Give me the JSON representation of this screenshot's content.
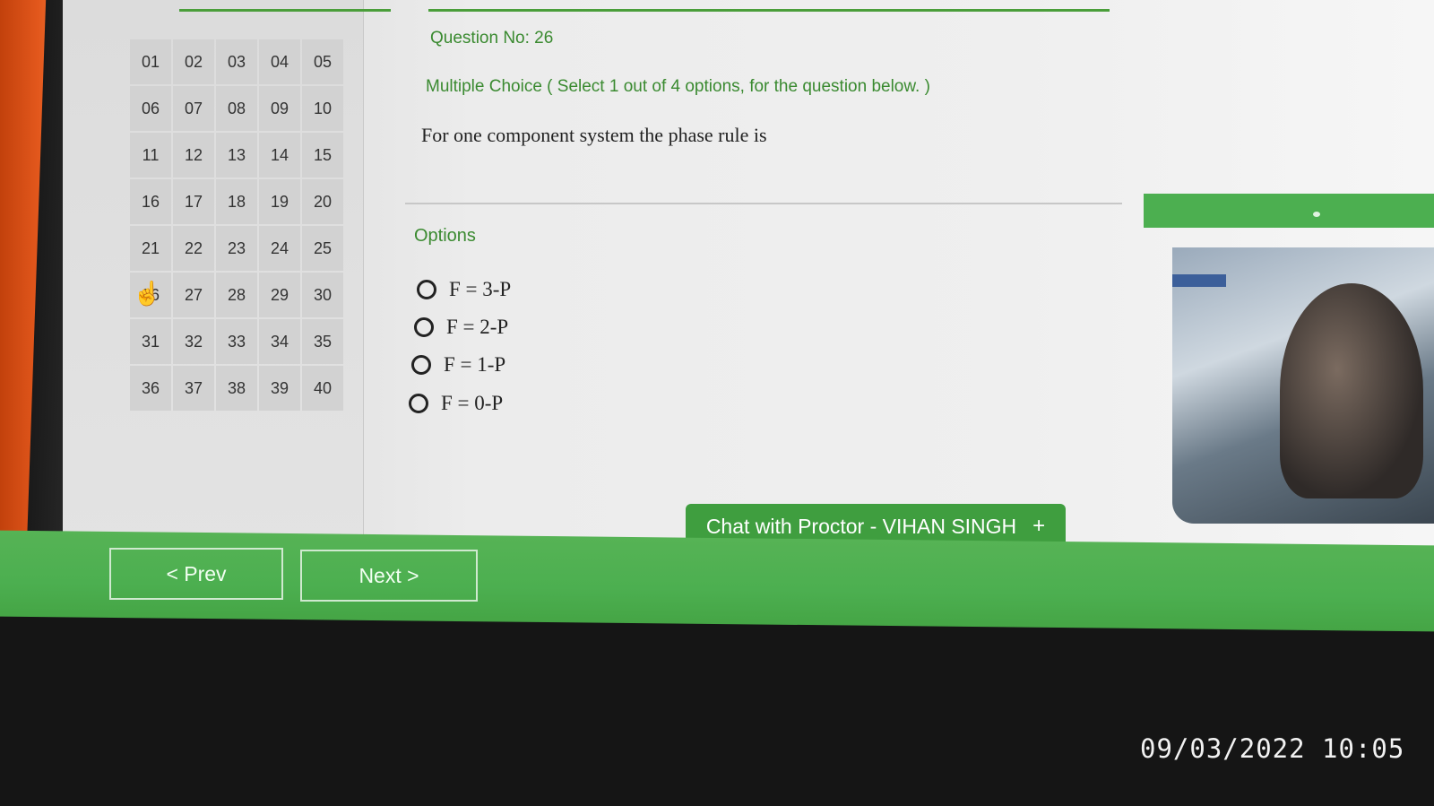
{
  "question_grid": [
    "01",
    "02",
    "03",
    "04",
    "05",
    "06",
    "07",
    "08",
    "09",
    "10",
    "11",
    "12",
    "13",
    "14",
    "15",
    "16",
    "17",
    "18",
    "19",
    "20",
    "21",
    "22",
    "23",
    "24",
    "25",
    "26",
    "27",
    "28",
    "29",
    "30",
    "31",
    "32",
    "33",
    "34",
    "35",
    "36",
    "37",
    "38",
    "39",
    "40"
  ],
  "question": {
    "number_label": "Question No: 26",
    "type_label": "Multiple Choice ( Select 1 out of 4 options, for the question below. )",
    "text": "For one component system the phase rule is"
  },
  "options": {
    "label": "Options",
    "items": [
      "F = 3-P",
      "F = 2-P",
      "F = 1-P",
      "F = 0-P"
    ]
  },
  "chat": {
    "label": "Chat with Proctor - VIHAN SINGH",
    "plus": "+"
  },
  "nav": {
    "prev_label": "< Prev",
    "next_label": "Next >"
  },
  "photo_timestamp": "09/03/2022 10:05",
  "colors": {
    "accent_green": "#4caf50",
    "text_green": "#3a8a30"
  }
}
